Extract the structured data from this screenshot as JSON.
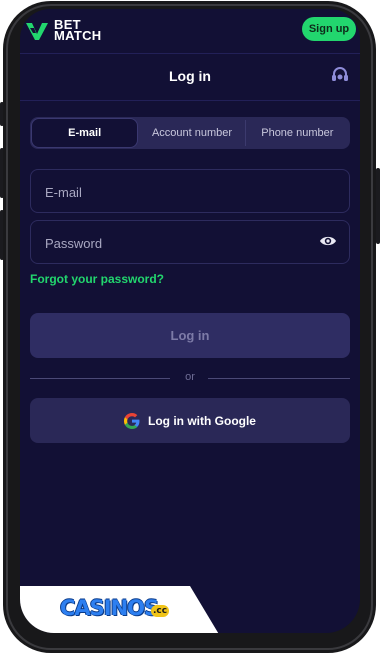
{
  "brand": {
    "line1": "BET",
    "line2": "MATCH",
    "logo_color": "#22d66e"
  },
  "header": {
    "signup_label": "Sign up"
  },
  "page": {
    "title": "Log in",
    "support_icon": "headset-icon"
  },
  "tabs": [
    {
      "label": "E-mail",
      "active": true
    },
    {
      "label": "Account number",
      "active": false
    },
    {
      "label": "Phone number",
      "active": false
    }
  ],
  "form": {
    "email": {
      "placeholder": "E-mail",
      "value": ""
    },
    "password": {
      "placeholder": "Password",
      "value": ""
    },
    "forgot_label": "Forgot your password?",
    "login_label": "Log in",
    "or_label": "or",
    "google_label": "Log in with Google"
  },
  "watermark": {
    "text": "CASINOS",
    "suffix": ".cc"
  },
  "colors": {
    "background": "#121035",
    "accent": "#22d66e",
    "field_border": "#2d2b5e",
    "button_disabled": "#2f2d63"
  }
}
